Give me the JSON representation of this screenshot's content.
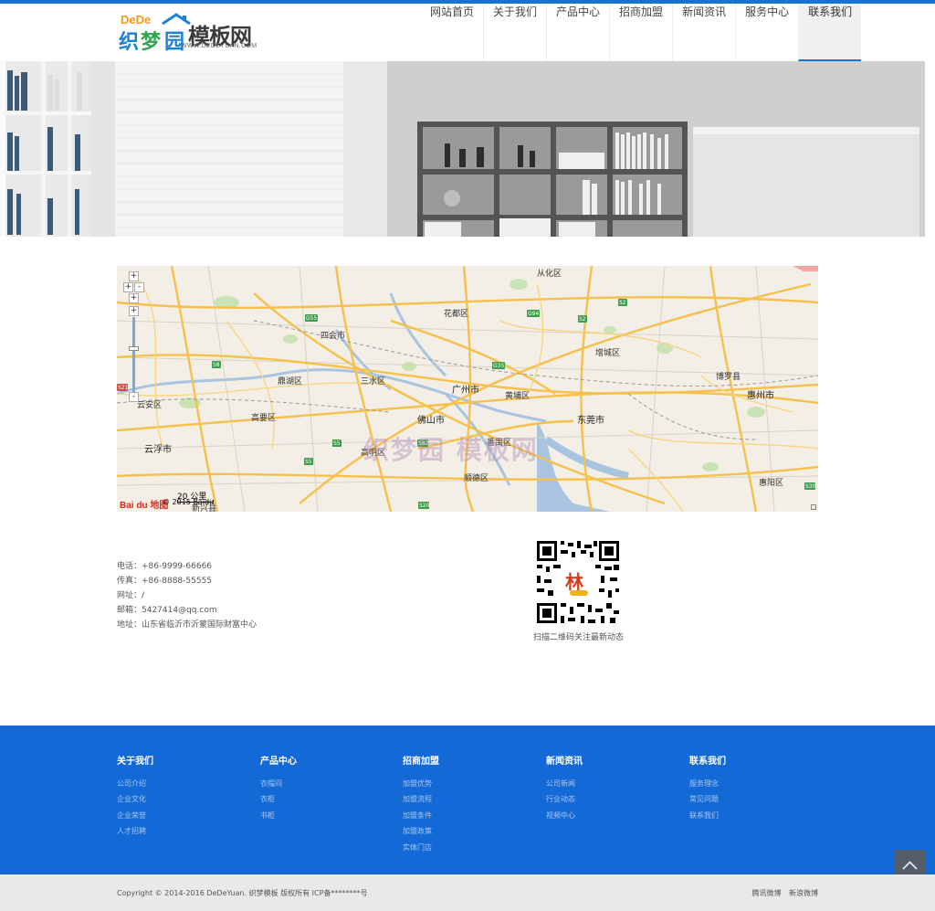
{
  "logo": {
    "dede": "DeDe",
    "name_parts": [
      "织",
      "梦",
      "园"
    ],
    "brand": "模板网",
    "url": "WWW.DEDEYUAN.COM"
  },
  "nav": {
    "items": [
      {
        "label": "网站首页"
      },
      {
        "label": "关于我们"
      },
      {
        "label": "产品中心"
      },
      {
        "label": "招商加盟"
      },
      {
        "label": "新闻资讯"
      },
      {
        "label": "服务中心"
      },
      {
        "label": "联系我们",
        "active": true
      }
    ]
  },
  "map": {
    "labels": {
      "conghua": "从化区",
      "huadu": "花都区",
      "sihui": "四会市",
      "zengcheng": "增城区",
      "dinghu": "鼎湖区",
      "sanshui": "三水区",
      "guangzhou": "广州市",
      "huangpu": "黄埔区",
      "boluo": "博罗县",
      "huizhou": "惠州市",
      "yunan": "云安区",
      "gaoyao": "高要区",
      "foshan": "佛山市",
      "dongguan": "东莞市",
      "yunfu": "云浮市",
      "gaoming": "高明区",
      "panyu": "番禺区",
      "shunde": "顺德区",
      "huiyang": "惠阳区",
      "xinxing": "新兴县"
    },
    "roads": [
      "G55",
      "G94",
      "S2",
      "S8",
      "G35",
      "S5",
      "S82",
      "S20",
      "S30",
      "S21"
    ],
    "scale": "20 公里",
    "copyright": "© 2015 Baidu",
    "baidu": "Bai du 地图",
    "watermark": "织梦园 模板网"
  },
  "contact": {
    "phone": "电话：+86-9999-66666",
    "fax": "传真：+86-8888-55555",
    "website": "网址：/",
    "email": "邮箱：5427414@qq.com",
    "address": "地址：山东省临沂市沂蒙国际财富中心",
    "qr_caption": "扫描二维码关注最新动态"
  },
  "footer": {
    "columns": [
      {
        "title": "关于我们",
        "links": [
          "公司介绍",
          "企业文化",
          "企业荣誉",
          "人才招聘"
        ]
      },
      {
        "title": "产品中心",
        "links": [
          "衣帽间",
          "衣柜",
          "书柜"
        ]
      },
      {
        "title": "招商加盟",
        "links": [
          "加盟优势",
          "加盟流程",
          "加盟条件",
          "加盟政策",
          "实体门店"
        ]
      },
      {
        "title": "新闻资讯",
        "links": [
          "公司新闻",
          "行业动态",
          "视频中心"
        ]
      },
      {
        "title": "联系我们",
        "links": [
          "服务理念",
          "常见问题",
          "联系我们"
        ]
      }
    ],
    "copyright": "Copyright © 2014-2016 DeDeYuan. 织梦模板 版权所有  ICP备********号",
    "social": [
      "腾讯微博",
      "新浪微博"
    ]
  },
  "colors": {
    "accent": "#1772d6",
    "footer_bg": "#1369d6",
    "footer_link": "#a9c7f0"
  }
}
